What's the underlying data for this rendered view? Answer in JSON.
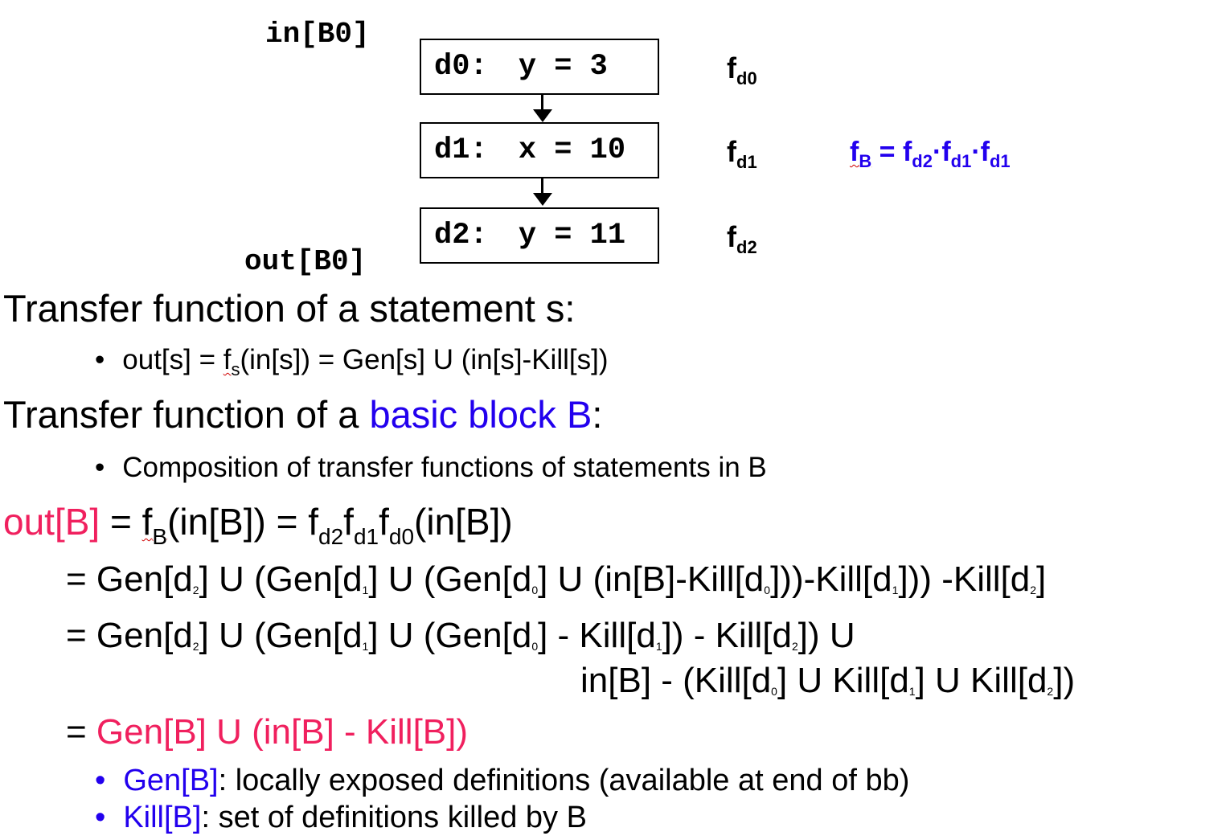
{
  "diagram": {
    "in_label": "in[B0]",
    "out_label": "out[B0]",
    "blocks": [
      {
        "label": "d0:",
        "code": "y = 3",
        "fn": "f",
        "fn_sub": "d0"
      },
      {
        "label": "d1:",
        "code": "x = 10",
        "fn": "f",
        "fn_sub": "d1"
      },
      {
        "label": "d2:",
        "code": "y = 11",
        "fn": "f",
        "fn_sub": "d2"
      }
    ],
    "fb_formula": {
      "f": "f",
      "b": "B",
      "eq": " = ",
      "t1": "f",
      "t1s": "d2",
      "dot1": "·",
      "t2": "f",
      "t2s": "d1",
      "dot2": "·",
      "t3": "f",
      "t3s": "d1"
    }
  },
  "statement_section": {
    "heading": "Transfer function of a statement s:",
    "bullet_pre": "out[s] = ",
    "bullet_f": "f",
    "bullet_fs": "s",
    "bullet_post": "(in[s]) = Gen[s] U (in[s]-Kill[s])"
  },
  "block_section": {
    "heading_pre": "Transfer function of a ",
    "heading_highlight": "basic block B",
    "heading_post": ":",
    "bullet": "Composition of transfer functions of statements in B"
  },
  "equation": {
    "lhs": "out[B]",
    "rhs_eq": " = ",
    "rhs_f": "f",
    "rhs_fsub": "B",
    "rhs_rest1": "(in[B]) = ",
    "rhs_f2": "f",
    "rhs_f2sub": "d2",
    "rhs_f3": "f",
    "rhs_f3sub": "d1",
    "rhs_f4": "f",
    "rhs_f4sub": "d0",
    "rhs_rest2": "(in[B])",
    "line2": {
      "p1": "= Gen[d",
      "s1": "2",
      "p2": "] U (Gen[d",
      "s2": "1",
      "p3": "] U (Gen[d",
      "s3": "0",
      "p4": "] U (in[B]-Kill[d",
      "s4": "0",
      "p5": "]))-Kill[d",
      "s5": "1",
      "p6": "])) -Kill[d",
      "s6": "2",
      "p7": "]"
    },
    "line3": {
      "p1": "= Gen[d",
      "s1": "2",
      "p2": "] U (Gen[d",
      "s2": "1",
      "p3": "] U (Gen[d",
      "s3": "0",
      "p4": "] - Kill[d",
      "s4": "1",
      "p5": "]) - Kill[d",
      "s5": "2",
      "p6": "]) U"
    },
    "line4": {
      "p1": "in[B] - (Kill[d",
      "s1": "0",
      "p2": "] U Kill[d",
      "s2": "1",
      "p3": "] U Kill[d",
      "s3": "2",
      "p4": "])"
    },
    "line5_pre": "= ",
    "line5_highlight": "Gen[B] U (in[B] - Kill[B])"
  },
  "definitions": [
    {
      "term": "Gen[B]",
      "desc": ": locally exposed definitions (available at end of bb)"
    },
    {
      "term": "Kill[B]",
      "desc": ": set of definitions killed by B"
    }
  ],
  "colors": {
    "blue": "#2200ee",
    "pink": "#f0205e",
    "squiggle": "#d00000"
  }
}
